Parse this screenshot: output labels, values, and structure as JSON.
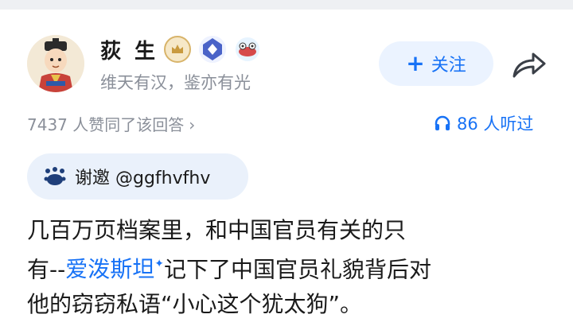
{
  "author": {
    "name": "荻 生",
    "bio": "维天有汉，鉴亦有光"
  },
  "actions": {
    "follow_label": "关注",
    "follow_plus": "+"
  },
  "meta": {
    "likes_text": "7437 人赞同了该回答",
    "likes_chevron": "›",
    "listeners_text": "86 人听过"
  },
  "invite": {
    "text": "谢邀 @ggfhvfhv"
  },
  "answer": {
    "line1": "几百万页档案里，和中国官员有关的只",
    "line2_prefix": "有--",
    "line2_link": "爱泼斯坦",
    "line2_link_mark": "✦",
    "line2_suffix": "记下了中国官员礼貌背后对",
    "line3": "他的窃窃私语“小心这个犹太狗”。"
  },
  "colors": {
    "accent": "#1772f6",
    "muted": "#8a8f99",
    "follow_bg": "#ebf3ff",
    "pill_bg": "#eaf1fb",
    "text": "#1a1a1a"
  },
  "icons": {
    "share": "share-arrow-icon",
    "listen": "headphones-icon",
    "invite": "invite-badge-icon"
  }
}
